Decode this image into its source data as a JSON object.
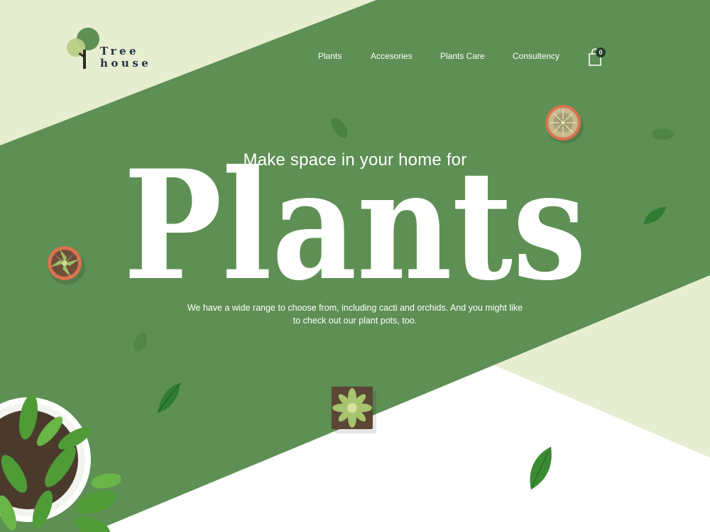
{
  "brand": {
    "line1": "Tree",
    "line2": "house"
  },
  "nav": {
    "items": [
      {
        "label": "Plants"
      },
      {
        "label": "Accesories"
      },
      {
        "label": "Plants Care"
      },
      {
        "label": "Consultency"
      }
    ],
    "cart_count": "0"
  },
  "hero": {
    "subtitle": "Make space in your home for",
    "headline": "Plants",
    "description_line1": "We have a wide range to choose from, including cacti and orchids. And you might like",
    "description_line2": "to check out our plant pots, too."
  },
  "colors": {
    "primary_green": "#5e8f54",
    "light_green": "#e6edd0",
    "navy": "#233447",
    "white": "#ffffff"
  },
  "icons": [
    "tree-logo-icon",
    "shopping-bag-icon",
    "leaf-icon",
    "cactus-pot-icon",
    "succulent-pot-icon",
    "potted-plant-icon"
  ]
}
